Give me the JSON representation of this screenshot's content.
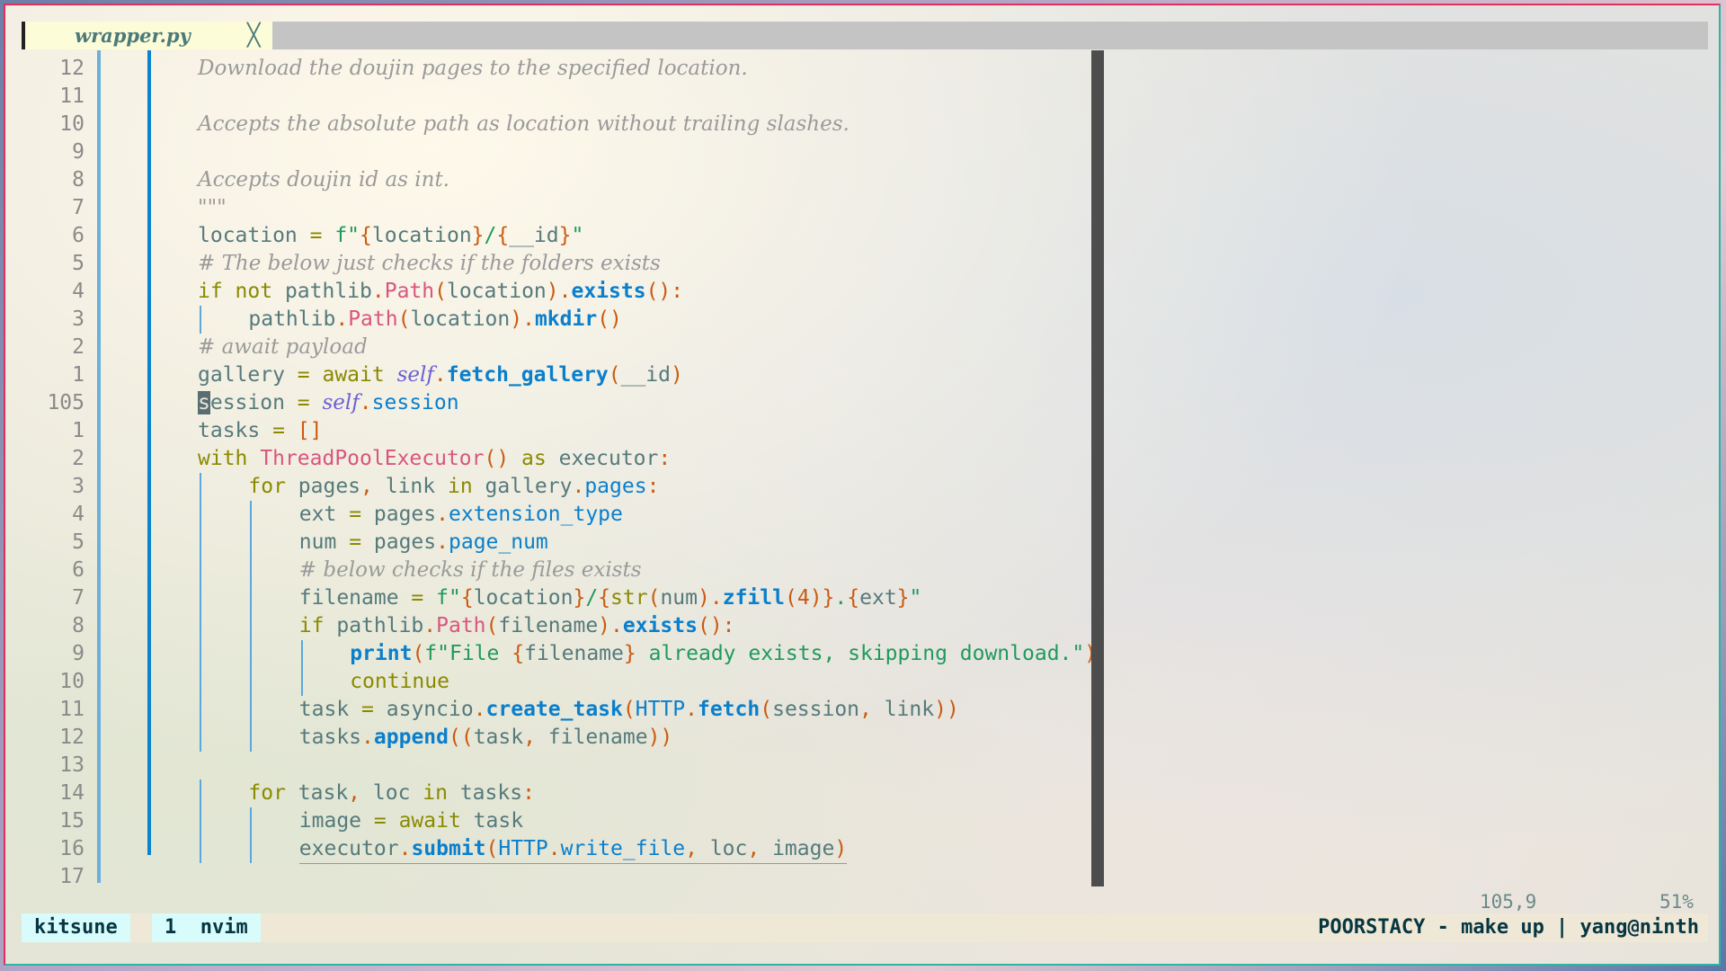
{
  "tab": {
    "filename": "wrapper.py",
    "close_icon": "close-icon"
  },
  "editor": {
    "lines": [
      {
        "num": "12",
        "indent": 0,
        "tokens": [
          [
            "Download the doujin pages to the specified location.",
            "d"
          ]
        ]
      },
      {
        "num": "11",
        "indent": 0,
        "tokens": []
      },
      {
        "num": "10",
        "indent": 0,
        "tokens": [
          [
            "Accepts the absolute path as location without trailing slashes.",
            "d"
          ]
        ]
      },
      {
        "num": "9",
        "indent": 0,
        "tokens": []
      },
      {
        "num": "8",
        "indent": 0,
        "tokens": [
          [
            "Accepts doujin id as int.",
            "d"
          ]
        ]
      },
      {
        "num": "7",
        "indent": 0,
        "tokens": [
          [
            "\"\"\"",
            "d"
          ]
        ]
      },
      {
        "num": "6",
        "indent": 0,
        "tokens": [
          [
            "location ",
            "n"
          ],
          [
            "= ",
            "k"
          ],
          [
            "f\"",
            "g"
          ],
          [
            "{",
            "p"
          ],
          [
            "location",
            "n"
          ],
          [
            "}",
            "p"
          ],
          [
            "/",
            "g"
          ],
          [
            "{",
            "p"
          ],
          [
            "__id",
            "n"
          ],
          [
            "}",
            "p"
          ],
          [
            "\"",
            "g"
          ]
        ]
      },
      {
        "num": "5",
        "indent": 0,
        "tokens": [
          [
            "# The below just checks if the folders exists",
            "cm"
          ]
        ]
      },
      {
        "num": "4",
        "indent": 0,
        "tokens": [
          [
            "if not ",
            "k"
          ],
          [
            "pathlib",
            "n"
          ],
          [
            ".",
            "p"
          ],
          [
            "Path",
            "c"
          ],
          [
            "(",
            "p"
          ],
          [
            "location",
            "n"
          ],
          [
            ")",
            "p"
          ],
          [
            ".",
            "p"
          ],
          [
            "exists",
            "f"
          ],
          [
            "():",
            "p"
          ]
        ]
      },
      {
        "num": "3",
        "indent": 1,
        "tokens": [
          [
            "pathlib",
            "n"
          ],
          [
            ".",
            "p"
          ],
          [
            "Path",
            "c"
          ],
          [
            "(",
            "p"
          ],
          [
            "location",
            "n"
          ],
          [
            ")",
            "p"
          ],
          [
            ".",
            "p"
          ],
          [
            "mkdir",
            "f"
          ],
          [
            "()",
            "p"
          ]
        ]
      },
      {
        "num": "2",
        "indent": 0,
        "tokens": [
          [
            "# await payload",
            "cm"
          ]
        ]
      },
      {
        "num": "1",
        "indent": 0,
        "tokens": [
          [
            "gallery ",
            "n"
          ],
          [
            "= await ",
            "k"
          ],
          [
            "self",
            "s"
          ],
          [
            ".",
            "p"
          ],
          [
            "fetch_gallery",
            "f"
          ],
          [
            "(",
            "p"
          ],
          [
            "__id",
            "n"
          ],
          [
            ")",
            "p"
          ]
        ]
      },
      {
        "num": "105",
        "indent": 0,
        "current": true,
        "tokens": [
          [
            "s",
            "cursor"
          ],
          [
            "ession ",
            "n"
          ],
          [
            "= ",
            "k"
          ],
          [
            "self",
            "s"
          ],
          [
            ".",
            "p"
          ],
          [
            "session",
            "f2"
          ]
        ]
      },
      {
        "num": "1",
        "indent": 0,
        "tokens": [
          [
            "tasks ",
            "n"
          ],
          [
            "= ",
            "k"
          ],
          [
            "[]",
            "p"
          ]
        ]
      },
      {
        "num": "2",
        "indent": 0,
        "tokens": [
          [
            "with ",
            "k"
          ],
          [
            "ThreadPoolExecutor",
            "c"
          ],
          [
            "() ",
            "p"
          ],
          [
            "as ",
            "k"
          ],
          [
            "executor",
            "n"
          ],
          [
            ":",
            "p"
          ]
        ]
      },
      {
        "num": "3",
        "indent": 1,
        "tokens": [
          [
            "for ",
            "k"
          ],
          [
            "pages",
            "n"
          ],
          [
            ", ",
            "p"
          ],
          [
            "link ",
            "n"
          ],
          [
            "in ",
            "k"
          ],
          [
            "gallery",
            "n"
          ],
          [
            ".",
            "p"
          ],
          [
            "pages",
            "f2"
          ],
          [
            ":",
            "p"
          ]
        ]
      },
      {
        "num": "4",
        "indent": 2,
        "tokens": [
          [
            "ext ",
            "n"
          ],
          [
            "= ",
            "k"
          ],
          [
            "pages",
            "n"
          ],
          [
            ".",
            "p"
          ],
          [
            "extension_type",
            "f2"
          ]
        ]
      },
      {
        "num": "5",
        "indent": 2,
        "tokens": [
          [
            "num ",
            "n"
          ],
          [
            "= ",
            "k"
          ],
          [
            "pages",
            "n"
          ],
          [
            ".",
            "p"
          ],
          [
            "page_num",
            "f2"
          ]
        ]
      },
      {
        "num": "6",
        "indent": 2,
        "tokens": [
          [
            "# below checks if the files exists",
            "cm"
          ]
        ]
      },
      {
        "num": "7",
        "indent": 2,
        "tokens": [
          [
            "filename ",
            "n"
          ],
          [
            "= ",
            "k"
          ],
          [
            "f\"",
            "g"
          ],
          [
            "{",
            "p"
          ],
          [
            "location",
            "n"
          ],
          [
            "}",
            "p"
          ],
          [
            "/",
            "g"
          ],
          [
            "{",
            "p"
          ],
          [
            "str",
            "k"
          ],
          [
            "(",
            "p"
          ],
          [
            "num",
            "n"
          ],
          [
            ")",
            "p"
          ],
          [
            ".",
            "p"
          ],
          [
            "zfill",
            "f"
          ],
          [
            "(",
            "p"
          ],
          [
            "4",
            "p"
          ],
          [
            ")",
            "p"
          ],
          [
            "}",
            "p"
          ],
          [
            ".",
            "g"
          ],
          [
            "{",
            "p"
          ],
          [
            "ext",
            "n"
          ],
          [
            "}",
            "p"
          ],
          [
            "\"",
            "g"
          ]
        ]
      },
      {
        "num": "8",
        "indent": 2,
        "tokens": [
          [
            "if ",
            "k"
          ],
          [
            "pathlib",
            "n"
          ],
          [
            ".",
            "p"
          ],
          [
            "Path",
            "c"
          ],
          [
            "(",
            "p"
          ],
          [
            "filename",
            "n"
          ],
          [
            ")",
            "p"
          ],
          [
            ".",
            "p"
          ],
          [
            "exists",
            "f"
          ],
          [
            "():",
            "p"
          ]
        ]
      },
      {
        "num": "9",
        "indent": 3,
        "tokens": [
          [
            "print",
            "f"
          ],
          [
            "(",
            "p"
          ],
          [
            "f\"File ",
            "g"
          ],
          [
            "{",
            "p"
          ],
          [
            "filename",
            "n"
          ],
          [
            "}",
            "p"
          ],
          [
            " already exists, skipping download.\"",
            "g"
          ],
          [
            ")",
            "p"
          ]
        ]
      },
      {
        "num": "10",
        "indent": 3,
        "tokens": [
          [
            "continue",
            "k"
          ]
        ]
      },
      {
        "num": "11",
        "indent": 2,
        "tokens": [
          [
            "task ",
            "n"
          ],
          [
            "= ",
            "k"
          ],
          [
            "asyncio",
            "n"
          ],
          [
            ".",
            "p"
          ],
          [
            "create_task",
            "f"
          ],
          [
            "(",
            "p"
          ],
          [
            "HTTP",
            "f2"
          ],
          [
            ".",
            "p"
          ],
          [
            "fetch",
            "f"
          ],
          [
            "(",
            "p"
          ],
          [
            "session",
            "n"
          ],
          [
            ", ",
            "p"
          ],
          [
            "link",
            "n"
          ],
          [
            "))",
            "p"
          ]
        ]
      },
      {
        "num": "12",
        "indent": 2,
        "tokens": [
          [
            "tasks",
            "n"
          ],
          [
            ".",
            "p"
          ],
          [
            "append",
            "f"
          ],
          [
            "((",
            "p"
          ],
          [
            "task",
            "n"
          ],
          [
            ", ",
            "p"
          ],
          [
            "filename",
            "n"
          ],
          [
            "))",
            "p"
          ]
        ]
      },
      {
        "num": "13",
        "indent": 0,
        "tokens": []
      },
      {
        "num": "14",
        "indent": 1,
        "tokens": [
          [
            "for ",
            "k"
          ],
          [
            "task",
            "n"
          ],
          [
            ", ",
            "p"
          ],
          [
            "loc ",
            "n"
          ],
          [
            "in ",
            "k"
          ],
          [
            "tasks",
            "n"
          ],
          [
            ":",
            "p"
          ]
        ]
      },
      {
        "num": "15",
        "indent": 2,
        "tokens": [
          [
            "image ",
            "n"
          ],
          [
            "= await ",
            "k"
          ],
          [
            "task",
            "n"
          ]
        ]
      },
      {
        "num": "16",
        "indent": 2,
        "underline": true,
        "tokens": [
          [
            "executor",
            "n"
          ],
          [
            ".",
            "p"
          ],
          [
            "submit",
            "f"
          ],
          [
            "(",
            "p"
          ],
          [
            "HTTP",
            "f2"
          ],
          [
            ".",
            "p"
          ],
          [
            "write_file",
            "f2"
          ],
          [
            ", ",
            "p"
          ],
          [
            "loc",
            "n"
          ],
          [
            ", ",
            "p"
          ],
          [
            "image",
            "n"
          ],
          [
            ")",
            "p"
          ]
        ]
      },
      {
        "num": "17",
        "indent": 0,
        "tokens": []
      }
    ]
  },
  "ruler": {
    "position": "105,9",
    "percent": "51%"
  },
  "statusbar": {
    "session": "kitsune",
    "window_index": "1",
    "window_name": "nvim",
    "right": "POORSTACY - make up | yang@ninth"
  }
}
